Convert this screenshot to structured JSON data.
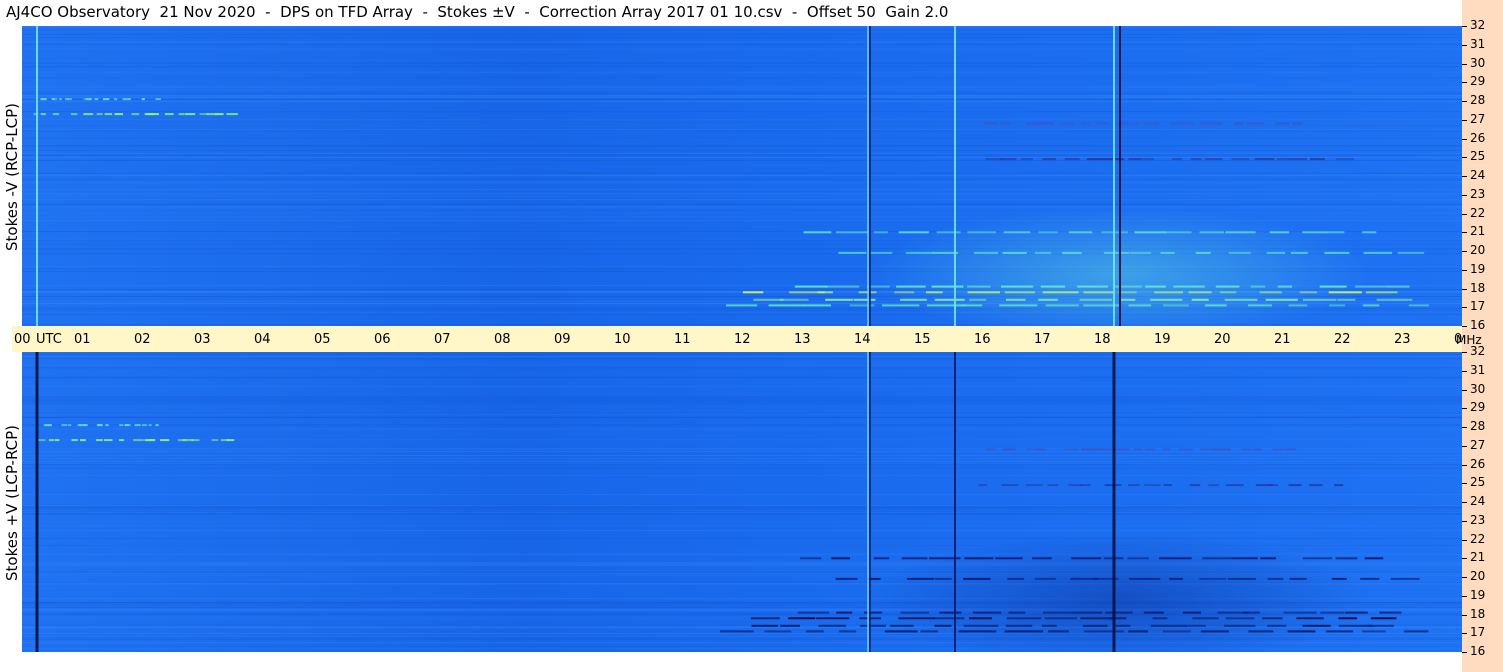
{
  "title": "AJ4CO Observatory  21 Nov 2020  -  DPS on TFD Array  -  Stokes ±V  -  Correction Array 2017 01 10.csv  -  Offset 50  Gain 2.0",
  "colors": {
    "background": "#1a6cf0",
    "timebar": "#fff7c8",
    "scalebar": "#ffdcc0"
  },
  "chart_data": [
    {
      "type": "heatmap",
      "ylabel": "Stokes -V (RCP-LCP)",
      "x_unit": "UTC",
      "y_unit": "MHz",
      "x": [
        "00",
        "01",
        "02",
        "03",
        "04",
        "05",
        "06",
        "07",
        "08",
        "09",
        "10",
        "11",
        "12",
        "13",
        "14",
        "15",
        "16",
        "17",
        "18",
        "19",
        "20",
        "21",
        "22",
        "23",
        "00"
      ],
      "xlim": [
        0,
        24
      ],
      "ylim": [
        16,
        32
      ],
      "yticks": [
        16,
        17,
        18,
        19,
        20,
        21,
        22,
        23,
        24,
        25,
        26,
        27,
        28,
        29,
        30,
        31,
        32
      ]
    },
    {
      "type": "heatmap",
      "ylabel": "Stokes +V (LCP-RCP)",
      "x_unit": "UTC",
      "y_unit": "MHz",
      "x": [
        "00",
        "01",
        "02",
        "03",
        "04",
        "05",
        "06",
        "07",
        "08",
        "09",
        "10",
        "11",
        "12",
        "13",
        "14",
        "15",
        "16",
        "17",
        "18",
        "19",
        "20",
        "21",
        "22",
        "23",
        "00"
      ],
      "xlim": [
        0,
        24
      ],
      "ylim": [
        16,
        32
      ],
      "yticks": [
        16,
        17,
        18,
        19,
        20,
        21,
        22,
        23,
        24,
        25,
        26,
        27,
        28,
        29,
        30,
        31,
        32
      ]
    }
  ],
  "timebar": {
    "utc_label": "UTC",
    "mhz_label": "MHz"
  }
}
